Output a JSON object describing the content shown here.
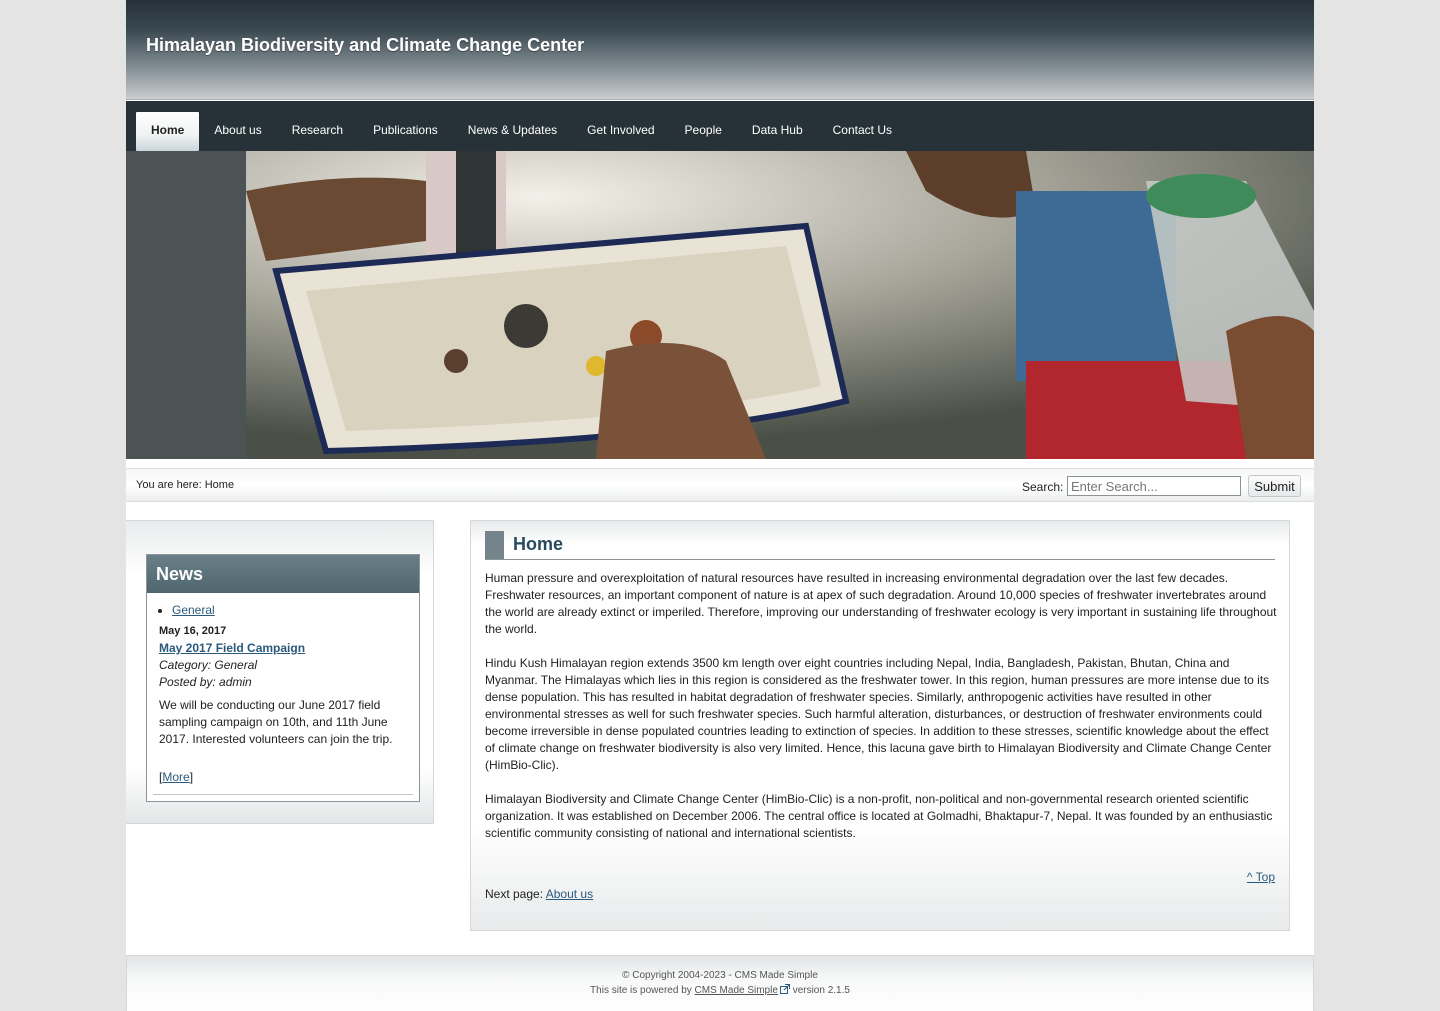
{
  "header": {
    "site_title": "Himalayan Biodiversity and Climate Change Center"
  },
  "menu": {
    "items": [
      {
        "label": "Home"
      },
      {
        "label": "About us"
      },
      {
        "label": "Research"
      },
      {
        "label": "Publications"
      },
      {
        "label": "News & Updates"
      },
      {
        "label": "Get Involved"
      },
      {
        "label": "People"
      },
      {
        "label": "Data Hub"
      },
      {
        "label": "Contact Us"
      }
    ]
  },
  "breadcrumb": {
    "prefix": "You are here:",
    "current": "Home"
  },
  "search": {
    "label": "Search:",
    "placeholder": "Enter Search...",
    "submit_label": "Submit"
  },
  "news": {
    "heading": "News",
    "category_link": "General",
    "date": "May 16, 2017",
    "title": "May 2017 Field Campaign",
    "category": "Category: General",
    "posted_by": "Posted by: admin",
    "summary": "We will be conducting our June 2017 field sampling campaign on 10th, and 11th June 2017. Interested volunteers can join the trip.",
    "more_open": "[",
    "more_label": "More",
    "more_close": "]"
  },
  "main": {
    "title": "Home",
    "paragraphs": [
      "Human pressure and overexploitation of natural resources have resulted in increasing environmental degradation over the last few decades. Freshwater resources, an important component of nature is at apex of such degradation. Around 10,000 species of freshwater invertebrates around the world are already extinct or imperiled. Therefore, improving our understanding of freshwater ecology is very important in sustaining life throughout the world.",
      "Hindu Kush Himalayan region extends 3500 km length over eight countries including Nepal, India, Bangladesh, Pakistan, Bhutan, China and Myanmar. The Himalayas which lies in this region is considered as the freshwater tower. In this region, human pressures are more intense due to its dense population. This has resulted in habitat degradation of freshwater species. Similarly, anthropogenic activities have resulted in other environmental stresses as well for such freshwater species. Such harmful alteration, disturbances, or destruction of freshwater environments could become irreversible in dense populated countries leading to extinction of species. In addition to these stresses, scientific knowledge about the effect of climate change on freshwater biodiversity is also very limited. Hence, this lacuna gave birth to Himalayan Biodiversity and Climate Change Center (HimBio-Clic).",
      "Himalayan Biodiversity and Climate Change Center (HimBio-Clic) is a non-profit, non-political and non-governmental research oriented scientific organization. It was established on December 2006. The central office is located at Golmadhi, Bhaktapur-7, Nepal. It was founded by an enthusiastic scientific community consisting of national and international scientists."
    ],
    "top_link": "^ Top",
    "next_page_label": "Next page:",
    "next_page_link": "About us"
  },
  "footer": {
    "copyright": "© Copyright 2004-2023 - CMS Made Simple",
    "powered_prefix": "This site is powered by",
    "powered_link": "CMS Made Simple",
    "powered_suffix": "version 2.1.5"
  },
  "banner": {
    "icon": "field-sampling-photo"
  }
}
